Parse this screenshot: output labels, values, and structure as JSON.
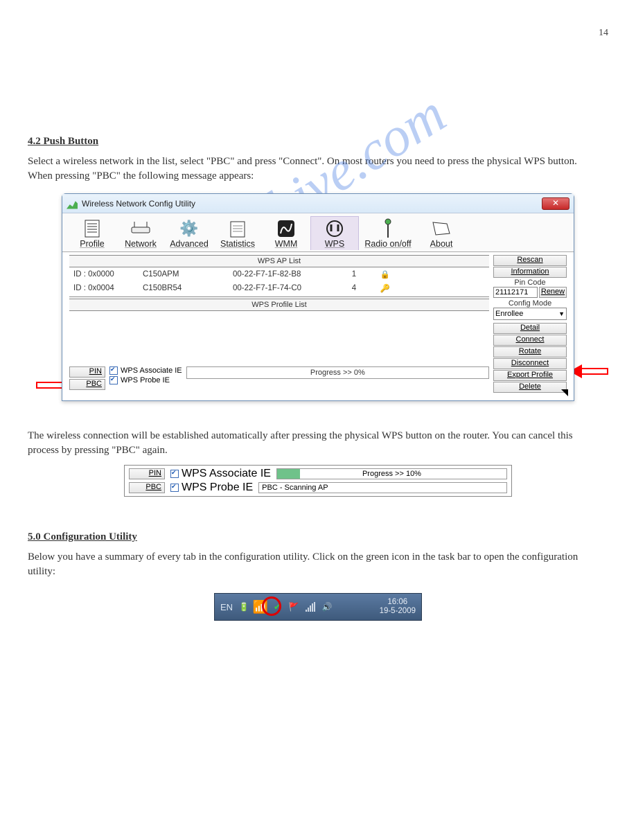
{
  "page_number": "14",
  "watermark": "manualshive.com",
  "section_heading": "4.2 Push Button",
  "intro_text_1": "Select a wireless network in the list, select \"PBC\" and press \"Connect\". On most routers you need to press the physical WPS button. When pressing \"PBC\" the following message appears:",
  "intro_text_2": "The wireless connection will be established automatically after pressing the physical WPS button on the router. You can cancel this process by pressing \"PBC\" again.",
  "intro_text_3": "Below you have a summary of every tab in the configuration utility. Click on the green icon in the task bar to open the configuration utility:",
  "section5_heading": "5.0 Configuration Utility",
  "window": {
    "title": "Wireless Network Config Utility",
    "tabs": {
      "profile": "Profile",
      "network": "Network",
      "advanced": "Advanced",
      "statistics": "Statistics",
      "wmm": "WMM",
      "wps": "WPS",
      "radio": "Radio on/off",
      "about": "About"
    },
    "ap_list_header": "WPS AP List",
    "ap_rows": [
      {
        "id": "ID : 0x0000",
        "ssid": "C150APM",
        "mac": "00-22-F7-1F-82-B8",
        "ch": "1"
      },
      {
        "id": "ID : 0x0004",
        "ssid": "C150BR54",
        "mac": "00-22-F7-1F-74-C0",
        "ch": "4"
      }
    ],
    "profile_list_header": "WPS Profile List",
    "btn_pin": "PIN",
    "btn_pbc": "PBC",
    "chk_assoc": "WPS Associate IE",
    "chk_probe": "WPS Probe IE",
    "progress_label": "Progress >> 0%",
    "side": {
      "rescan": "Rescan",
      "information": "Information",
      "pin_code_lbl": "Pin Code",
      "pin_code_val": "21112171",
      "renew": "Renew",
      "config_mode_lbl": "Config Mode",
      "config_mode_val": "Enrollee",
      "detail": "Detail",
      "connect": "Connect",
      "rotate": "Rotate",
      "disconnect": "Disconnect",
      "export": "Export Profile",
      "delete": "Delete"
    }
  },
  "snippet": {
    "btn_pin": "PIN",
    "btn_pbc": "PBC",
    "chk_assoc": "WPS Associate IE",
    "chk_probe": "WPS Probe IE",
    "progress_label": "Progress >> 10%",
    "status": "PBC - Scanning AP"
  },
  "taskbar": {
    "lang": "EN",
    "time": "16:06",
    "date": "19-5-2009"
  }
}
